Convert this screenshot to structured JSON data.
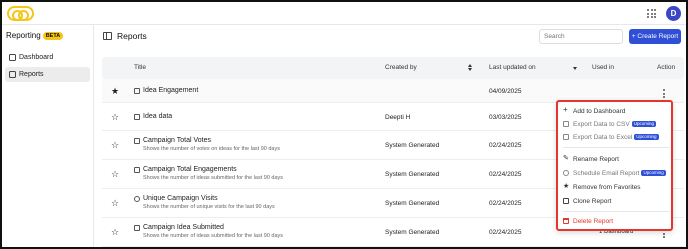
{
  "app": {
    "name": "Reporting",
    "badge": "BETA",
    "avatar_initial": "D"
  },
  "sidebar": {
    "items": [
      {
        "label": "Dashboard",
        "icon": "dashboard-icon",
        "active": false
      },
      {
        "label": "Reports",
        "icon": "reports-icon",
        "active": true
      }
    ]
  },
  "header": {
    "title": "Reports",
    "search_placeholder": "Search",
    "create_label": "+ Create Report"
  },
  "table": {
    "columns": {
      "title": "Title",
      "created_by": "Created by",
      "last_updated": "Last updated on",
      "used_in": "Used in",
      "action": "Action"
    },
    "rows": [
      {
        "name": "Idea Engagement",
        "subtitle": "",
        "created_by": "",
        "updated": "04/09/2025",
        "favorite": true,
        "icon": "report-icon"
      },
      {
        "name": "Idea data",
        "subtitle": "",
        "created_by": "Deepti H",
        "updated": "03/03/2025",
        "favorite": false,
        "icon": "report-icon"
      },
      {
        "name": "Campaign Total Votes",
        "subtitle": "Shows the number of votes on ideas for the last 90 days",
        "created_by": "System Generated",
        "updated": "02/24/2025",
        "favorite": false,
        "icon": "report-icon"
      },
      {
        "name": "Campaign Total Engagements",
        "subtitle": "Shows the number of ideas submitted for the last 90 days",
        "created_by": "System Generated",
        "updated": "02/24/2025",
        "favorite": false,
        "icon": "report-icon"
      },
      {
        "name": "Unique Campaign Visits",
        "subtitle": "Shows the number of unique visits for the last 90 days",
        "created_by": "System Generated",
        "updated": "02/24/2025",
        "favorite": false,
        "icon": "clock-icon"
      },
      {
        "name": "Campaign Idea Submitted",
        "subtitle": "Shows the number of ideas submitted for the last 90 days",
        "created_by": "System Generated",
        "updated": "02/24/2025",
        "favorite": false,
        "icon": "report-icon"
      }
    ],
    "last_row_used_in": "1 Dashboard"
  },
  "menu": {
    "items": [
      {
        "label": "Add to Dashboard",
        "icon": "plus-icon",
        "upcoming": false
      },
      {
        "label": "Export Data to CSV",
        "icon": "file-icon",
        "upcoming": true
      },
      {
        "label": "Export Data to Excel",
        "icon": "file-icon",
        "upcoming": true
      },
      {
        "label": "Rename Report",
        "icon": "pencil-icon",
        "upcoming": false
      },
      {
        "label": "Schedule Email Report",
        "icon": "clock-icon",
        "upcoming": true
      },
      {
        "label": "Remove from Favorites",
        "icon": "star-filled-icon",
        "upcoming": false
      },
      {
        "label": "Clone Report",
        "icon": "copy-icon",
        "upcoming": false
      },
      {
        "label": "Delete Report",
        "icon": "trash-icon",
        "upcoming": false
      }
    ],
    "upcoming_label": "Upcoming"
  },
  "colors": {
    "accent": "#2f4fd6",
    "beta": "#f5c518",
    "danger": "#e2372a"
  }
}
